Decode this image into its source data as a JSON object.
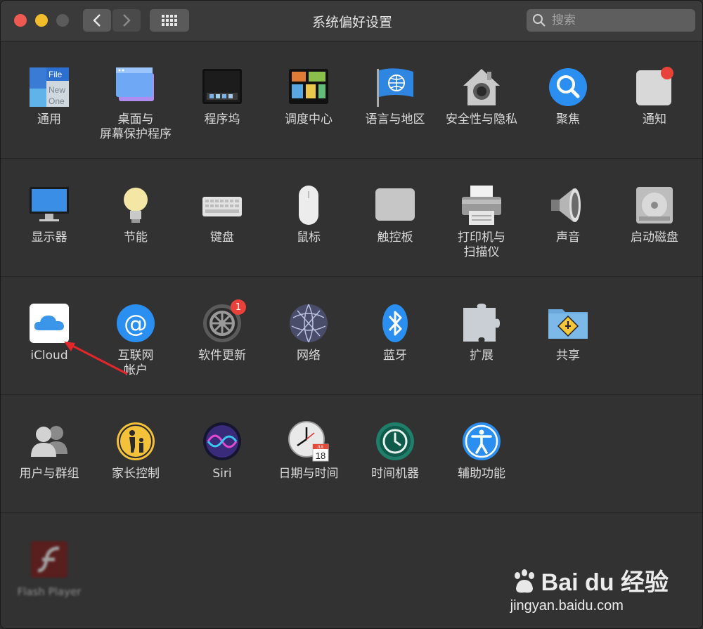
{
  "window": {
    "title": "系统偏好设置",
    "search_placeholder": "搜索"
  },
  "rows": [
    [
      {
        "label": "通用"
      },
      {
        "label": "桌面与\n屏幕保护程序"
      },
      {
        "label": "程序坞"
      },
      {
        "label": "调度中心"
      },
      {
        "label": "语言与地区"
      },
      {
        "label": "安全性与隐私"
      },
      {
        "label": "聚焦"
      },
      {
        "label": "通知"
      }
    ],
    [
      {
        "label": "显示器"
      },
      {
        "label": "节能"
      },
      {
        "label": "键盘"
      },
      {
        "label": "鼠标"
      },
      {
        "label": "触控板"
      },
      {
        "label": "打印机与\n扫描仪"
      },
      {
        "label": "声音"
      },
      {
        "label": "启动磁盘"
      }
    ],
    [
      {
        "label": "iCloud"
      },
      {
        "label": "互联网\n帐户"
      },
      {
        "label": "软件更新",
        "badge": "1"
      },
      {
        "label": "网络"
      },
      {
        "label": "蓝牙"
      },
      {
        "label": "扩展"
      },
      {
        "label": "共享"
      }
    ],
    [
      {
        "label": "用户与群组"
      },
      {
        "label": "家长控制"
      },
      {
        "label": "Siri"
      },
      {
        "label": "日期与时间"
      },
      {
        "label": "时间机器"
      },
      {
        "label": "辅助功能"
      }
    ],
    [
      {
        "label": "Flash Player"
      }
    ]
  ],
  "icon_labels": {
    "general_file": "File",
    "general_new": "New",
    "general_one": "One",
    "calendar_month": "JUL",
    "calendar_day": "18"
  },
  "watermark": {
    "brand": "Bai du 经验",
    "url": "jingyan.baidu.com"
  }
}
